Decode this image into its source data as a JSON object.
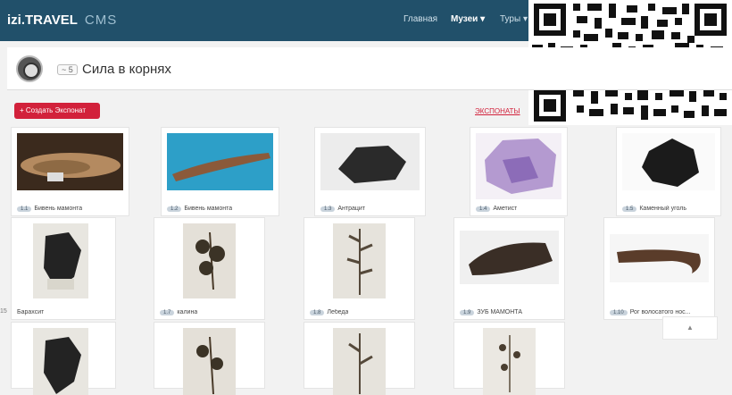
{
  "app": {
    "brand": "izi.TRAVEL",
    "brand_suffix": "CMS"
  },
  "nav": {
    "items": [
      {
        "label": "Главная"
      },
      {
        "label": "Музеи ▾"
      },
      {
        "label": "Туры ▾"
      }
    ]
  },
  "header": {
    "badge": "~ 5",
    "title": "Сила в корнях"
  },
  "actions": {
    "create_label": "+ Создать Экспонат",
    "exhibits_link": "ЭКСПОНАТЫ"
  },
  "row1": [
    {
      "num": "1.1",
      "name": "Бивень мамонта"
    },
    {
      "num": "1.2",
      "name": "Бивень мамонта"
    },
    {
      "num": "1.3",
      "name": "Антрацит"
    },
    {
      "num": "1.4",
      "name": "Аметист"
    },
    {
      "num": "1.5",
      "name": "Каменный уголь"
    }
  ],
  "row2": [
    {
      "num": "",
      "name": "Барахсит"
    },
    {
      "num": "1.7",
      "name": "калина"
    },
    {
      "num": "1.8",
      "name": "Лебеда"
    },
    {
      "num": "1.9",
      "name": "ЗУБ МАМОНТА"
    },
    {
      "num": "1.10",
      "name": "Рог волосатого нос..."
    }
  ],
  "left_marker": "15",
  "scroll_label": "▲",
  "colors": {
    "topbar": "#21506a",
    "accent_red": "#d2213b"
  }
}
